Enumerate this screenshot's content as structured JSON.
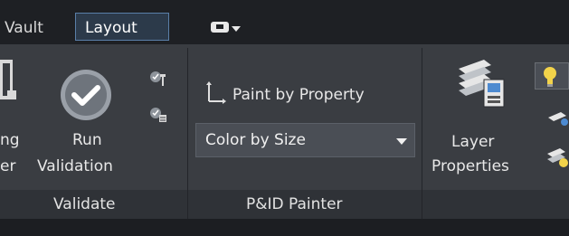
{
  "tabs": {
    "vault": "Vault",
    "layout": "Layout"
  },
  "validate": {
    "partial_label_line1": "ng",
    "partial_label_line2": "er",
    "run_label_line1": "Run",
    "run_label_line2": "Validation",
    "panel_label": "Validate"
  },
  "painter": {
    "paint_by_property_label": "Paint by Property",
    "dropdown_value": "Color by Size",
    "panel_label": "P&ID Painter"
  },
  "layers": {
    "layer_properties_line1": "Layer",
    "layer_properties_line2": "Properties"
  },
  "colors": {
    "accent": "#5a7fa8",
    "ribbon_bg": "#3a3d42",
    "topbar_bg": "#1e2024"
  },
  "icons": {
    "quick_access": "display-icon",
    "run_validation": "checkmark-circle-icon",
    "validation_settings": "check-settings-icon",
    "validation_list": "check-list-icon",
    "paint_by_property": "axis-icon",
    "layer_properties": "layer-properties-icon",
    "bulb": "lightbulb-icon"
  }
}
